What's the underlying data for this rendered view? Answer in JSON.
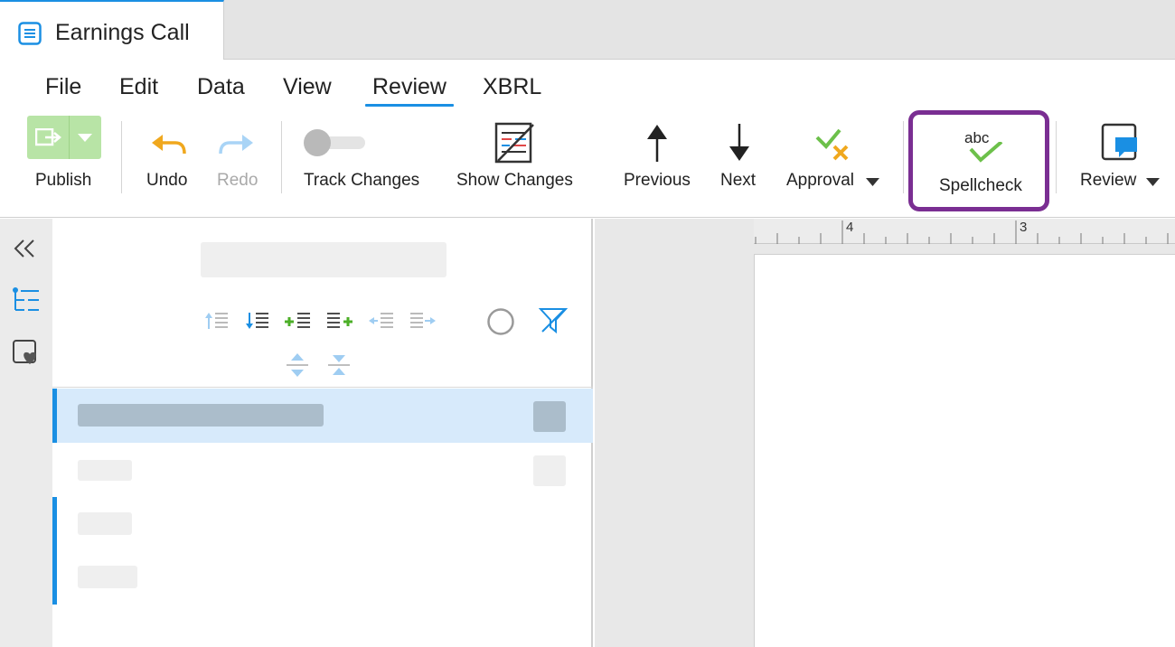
{
  "tab": {
    "title": "Earnings Call",
    "icon": "document-icon"
  },
  "menu": {
    "items": [
      "File",
      "Edit",
      "Data",
      "View",
      "Review",
      "XBRL"
    ],
    "active": "Review"
  },
  "toolbar": {
    "publish": "Publish",
    "undo": "Undo",
    "redo": "Redo",
    "track_changes": "Track Changes",
    "show_changes": "Show Changes",
    "previous": "Previous",
    "next": "Next",
    "approval": "Approval",
    "spellcheck": "Spellcheck",
    "spellcheck_icon_text": "abc",
    "review": "Review"
  },
  "ruler": {
    "labels": [
      "4",
      "3"
    ]
  },
  "colors": {
    "accent": "#1a8fe3",
    "highlight": "#7a2e92",
    "publish": "#b8e4a6",
    "approve": "#6cc04a",
    "reject": "#f0a81e"
  }
}
